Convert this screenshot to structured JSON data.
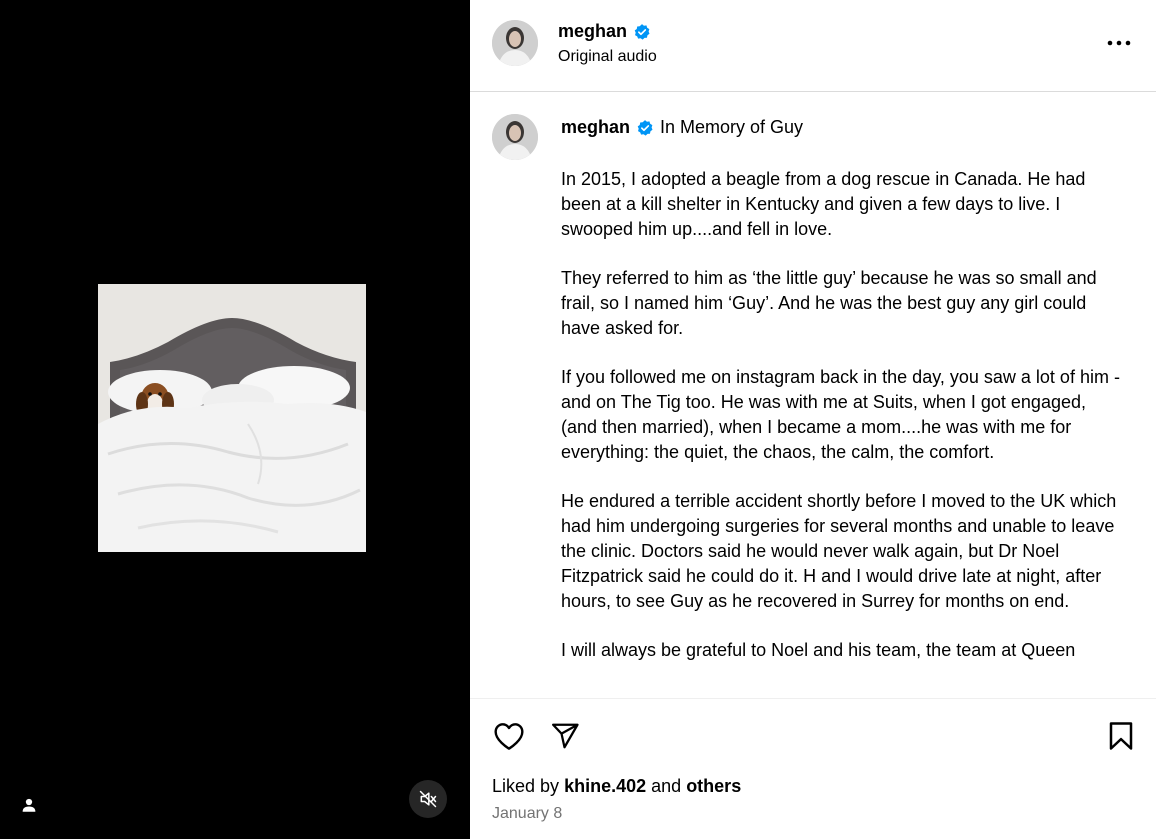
{
  "header": {
    "username": "meghan",
    "subtitle": "Original audio",
    "more_icon": "more-horizontal-icon"
  },
  "caption": {
    "username": "meghan",
    "title": "In Memory of Guy",
    "paragraphs": [
      "In 2015, I adopted a beagle from a dog rescue in Canada. He had been at a kill shelter in Kentucky and given a few days to live. I swooped him up....and fell in love.",
      "They referred to him as ‘the little guy’ because he was so small and frail, so I named him ‘Guy’. And he was the best guy any girl could have asked for.",
      "If you followed me on instagram back in the day, you saw a lot of him - and on The Tig too. He was with me at Suits, when I got engaged, (and then married), when I became a mom....he was with me for everything: the quiet, the chaos, the calm, the comfort.",
      "He endured a terrible accident shortly before I moved to the UK which had him undergoing surgeries for several months and unable to leave the clinic. Doctors said he would never walk again, but Dr Noel Fitzpatrick said he could do it. H and I would drive late at night, after hours, to see Guy as he recovered in Surrey for months on end.",
      "I will always be grateful to Noel and his team, the team at Queen"
    ]
  },
  "footer": {
    "liked_by_prefix": "Liked by",
    "liked_by_user": "khine.402",
    "liked_by_and": "and",
    "liked_by_others": "others",
    "date": "January 8"
  },
  "icons": {
    "like": "heart-icon",
    "share": "send-icon",
    "save": "bookmark-icon",
    "tag": "user-tag-icon",
    "mute": "audio-muted-icon",
    "verified": "verified-badge-icon"
  },
  "colors": {
    "verified": "#0095f6",
    "secondary_text": "#737373",
    "media_bg": "#000000"
  }
}
